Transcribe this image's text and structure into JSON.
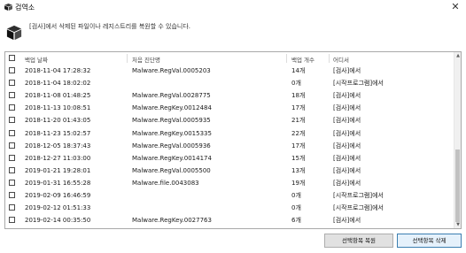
{
  "window": {
    "title": "검역소",
    "close_glyph": "✕"
  },
  "description": "[검사]에서 삭제된 파일이나 레지스트리를 복원할 수 있습니다.",
  "table": {
    "columns": {
      "date": "백업 날짜",
      "first_detection": "처음 진단명",
      "backup_count": "백업 개수",
      "source": "어디서"
    },
    "rows": [
      {
        "date": "2018-11-04 17:28:32",
        "detection": "Malware.RegVal.0005203",
        "count": "14개",
        "source": "[검사]에서"
      },
      {
        "date": "2018-11-04 18:02:02",
        "detection": "",
        "count": "0개",
        "source": "[시작프로그램]에서"
      },
      {
        "date": "2018-11-08 01:48:25",
        "detection": "Malware.RegVal.0028775",
        "count": "18개",
        "source": "[검사]에서"
      },
      {
        "date": "2018-11-13 10:08:51",
        "detection": "Malware.RegKey.0012484",
        "count": "17개",
        "source": "[검사]에서"
      },
      {
        "date": "2018-11-20 01:43:05",
        "detection": "Malware.RegVal.0005935",
        "count": "21개",
        "source": "[검사]에서"
      },
      {
        "date": "2018-11-23 15:02:57",
        "detection": "Malware.RegKey.0015335",
        "count": "22개",
        "source": "[검사]에서"
      },
      {
        "date": "2018-12-05 18:37:43",
        "detection": "Malware.RegVal.0005936",
        "count": "17개",
        "source": "[검사]에서"
      },
      {
        "date": "2018-12-27 11:03:00",
        "detection": "Malware.RegKey.0014174",
        "count": "15개",
        "source": "[검사]에서"
      },
      {
        "date": "2019-01-21 19:28:01",
        "detection": "Malware.RegVal.0005500",
        "count": "13개",
        "source": "[검사]에서"
      },
      {
        "date": "2019-01-31 16:55:28",
        "detection": "Malware.file.0043083",
        "count": "19개",
        "source": "[검사]에서"
      },
      {
        "date": "2019-02-09 16:46:59",
        "detection": "",
        "count": "0개",
        "source": "[시작프로그램]에서"
      },
      {
        "date": "2019-02-12 01:51:33",
        "detection": "",
        "count": "0개",
        "source": "[시작프로그램]에서"
      },
      {
        "date": "2019-02-14 00:35:50",
        "detection": "Malware.RegKey.0027763",
        "count": "6개",
        "source": "[검사]에서"
      }
    ]
  },
  "buttons": {
    "restore": "선택항목 복원",
    "delete": "선택항목 삭제"
  },
  "icons": {
    "app": "cube-icon",
    "header": "cube-icon",
    "close": "close-icon"
  }
}
